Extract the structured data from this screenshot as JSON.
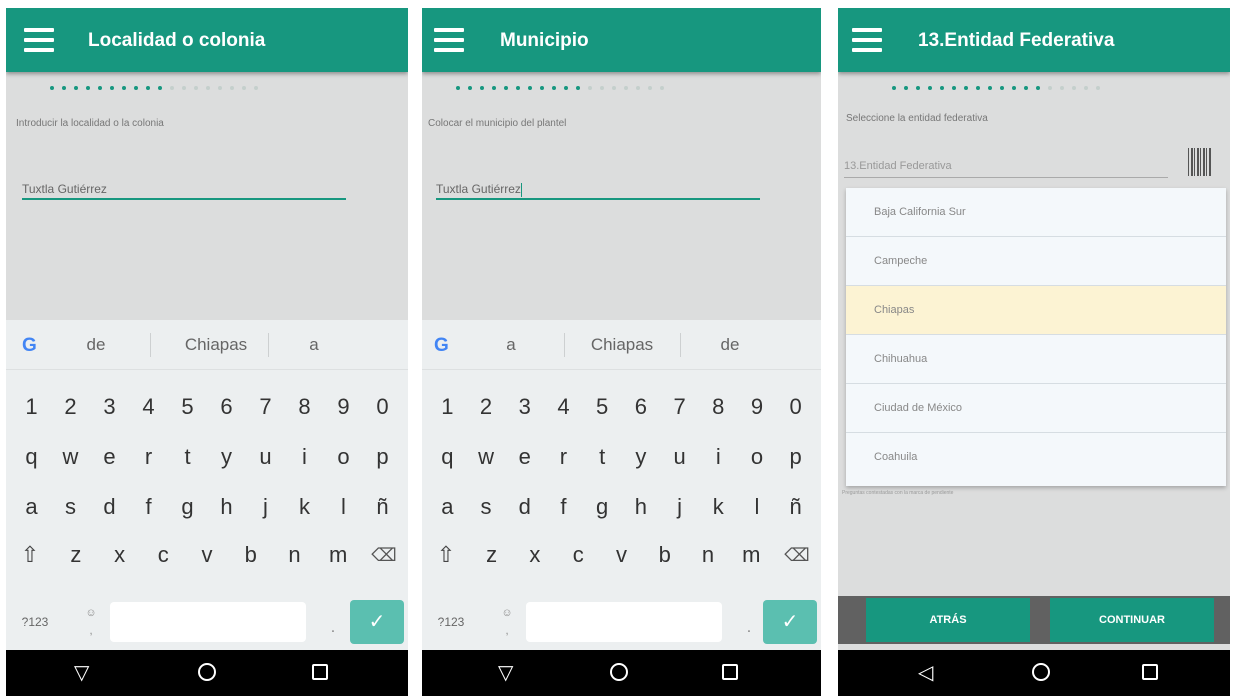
{
  "screens": {
    "localidad": {
      "title": "Localidad o colonia",
      "progress": {
        "filled": 10,
        "total": 18
      },
      "instruction": "Introducir la localidad o la colonia",
      "input_value": "Tuxtla Gutiérrez",
      "suggestions": [
        "de",
        "Chiapas",
        "a"
      ]
    },
    "municipio": {
      "title": "Municipio",
      "progress": {
        "filled": 11,
        "total": 18
      },
      "instruction": "Colocar el municipio del plantel",
      "input_value": "Tuxtla Gutiérrez",
      "suggestions": [
        "a",
        "Chiapas",
        "de"
      ]
    },
    "entidad": {
      "title": "13.Entidad Federativa",
      "progress": {
        "filled": 13,
        "total": 18
      },
      "instruction": "Seleccione la entidad federativa",
      "field_placeholder": "13.Entidad Federativa",
      "options": [
        "Baja California Sur",
        "Campeche",
        "Chiapas",
        "Chihuahua",
        "Ciudad de México",
        "Coahuila"
      ],
      "selected_option": "Chiapas",
      "footnote": "Preguntas contestadas con la marca de pendiente",
      "back_label": "ATRÁS",
      "continue_label": "CONTINUAR"
    }
  },
  "keyboard": {
    "numbers": [
      "1",
      "2",
      "3",
      "4",
      "5",
      "6",
      "7",
      "8",
      "9",
      "0"
    ],
    "row1": [
      "q",
      "w",
      "e",
      "r",
      "t",
      "y",
      "u",
      "i",
      "o",
      "p"
    ],
    "row2": [
      "a",
      "s",
      "d",
      "f",
      "g",
      "h",
      "j",
      "k",
      "l",
      "ñ"
    ],
    "row3": [
      "z",
      "x",
      "c",
      "v",
      "b",
      "n",
      "m"
    ],
    "symbols_label": "?123",
    "google_label": "G"
  },
  "colors": {
    "primary": "#17977f",
    "selected_row": "#fcf3d3",
    "enter_key": "#5bbfb0"
  },
  "icons": [
    "hamburger-menu-icon",
    "shift-icon",
    "backspace-icon",
    "check-icon",
    "barcode-icon",
    "nav-back-icon",
    "nav-home-icon",
    "nav-recent-icon"
  ]
}
